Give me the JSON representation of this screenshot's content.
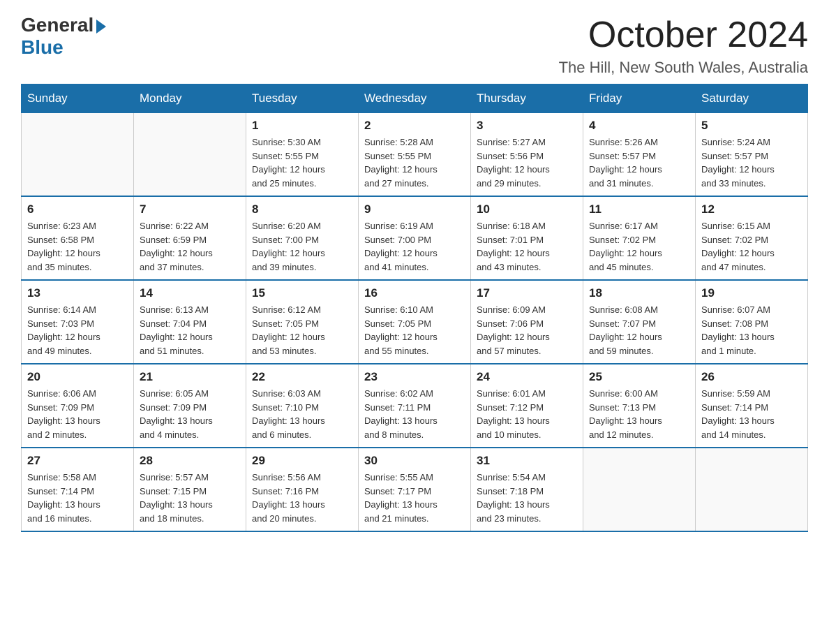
{
  "logo": {
    "general": "General",
    "blue": "Blue"
  },
  "header": {
    "month_year": "October 2024",
    "location": "The Hill, New South Wales, Australia"
  },
  "days_of_week": [
    "Sunday",
    "Monday",
    "Tuesday",
    "Wednesday",
    "Thursday",
    "Friday",
    "Saturday"
  ],
  "weeks": [
    [
      {
        "day": "",
        "info": ""
      },
      {
        "day": "",
        "info": ""
      },
      {
        "day": "1",
        "info": "Sunrise: 5:30 AM\nSunset: 5:55 PM\nDaylight: 12 hours\nand 25 minutes."
      },
      {
        "day": "2",
        "info": "Sunrise: 5:28 AM\nSunset: 5:55 PM\nDaylight: 12 hours\nand 27 minutes."
      },
      {
        "day": "3",
        "info": "Sunrise: 5:27 AM\nSunset: 5:56 PM\nDaylight: 12 hours\nand 29 minutes."
      },
      {
        "day": "4",
        "info": "Sunrise: 5:26 AM\nSunset: 5:57 PM\nDaylight: 12 hours\nand 31 minutes."
      },
      {
        "day": "5",
        "info": "Sunrise: 5:24 AM\nSunset: 5:57 PM\nDaylight: 12 hours\nand 33 minutes."
      }
    ],
    [
      {
        "day": "6",
        "info": "Sunrise: 6:23 AM\nSunset: 6:58 PM\nDaylight: 12 hours\nand 35 minutes."
      },
      {
        "day": "7",
        "info": "Sunrise: 6:22 AM\nSunset: 6:59 PM\nDaylight: 12 hours\nand 37 minutes."
      },
      {
        "day": "8",
        "info": "Sunrise: 6:20 AM\nSunset: 7:00 PM\nDaylight: 12 hours\nand 39 minutes."
      },
      {
        "day": "9",
        "info": "Sunrise: 6:19 AM\nSunset: 7:00 PM\nDaylight: 12 hours\nand 41 minutes."
      },
      {
        "day": "10",
        "info": "Sunrise: 6:18 AM\nSunset: 7:01 PM\nDaylight: 12 hours\nand 43 minutes."
      },
      {
        "day": "11",
        "info": "Sunrise: 6:17 AM\nSunset: 7:02 PM\nDaylight: 12 hours\nand 45 minutes."
      },
      {
        "day": "12",
        "info": "Sunrise: 6:15 AM\nSunset: 7:02 PM\nDaylight: 12 hours\nand 47 minutes."
      }
    ],
    [
      {
        "day": "13",
        "info": "Sunrise: 6:14 AM\nSunset: 7:03 PM\nDaylight: 12 hours\nand 49 minutes."
      },
      {
        "day": "14",
        "info": "Sunrise: 6:13 AM\nSunset: 7:04 PM\nDaylight: 12 hours\nand 51 minutes."
      },
      {
        "day": "15",
        "info": "Sunrise: 6:12 AM\nSunset: 7:05 PM\nDaylight: 12 hours\nand 53 minutes."
      },
      {
        "day": "16",
        "info": "Sunrise: 6:10 AM\nSunset: 7:05 PM\nDaylight: 12 hours\nand 55 minutes."
      },
      {
        "day": "17",
        "info": "Sunrise: 6:09 AM\nSunset: 7:06 PM\nDaylight: 12 hours\nand 57 minutes."
      },
      {
        "day": "18",
        "info": "Sunrise: 6:08 AM\nSunset: 7:07 PM\nDaylight: 12 hours\nand 59 minutes."
      },
      {
        "day": "19",
        "info": "Sunrise: 6:07 AM\nSunset: 7:08 PM\nDaylight: 13 hours\nand 1 minute."
      }
    ],
    [
      {
        "day": "20",
        "info": "Sunrise: 6:06 AM\nSunset: 7:09 PM\nDaylight: 13 hours\nand 2 minutes."
      },
      {
        "day": "21",
        "info": "Sunrise: 6:05 AM\nSunset: 7:09 PM\nDaylight: 13 hours\nand 4 minutes."
      },
      {
        "day": "22",
        "info": "Sunrise: 6:03 AM\nSunset: 7:10 PM\nDaylight: 13 hours\nand 6 minutes."
      },
      {
        "day": "23",
        "info": "Sunrise: 6:02 AM\nSunset: 7:11 PM\nDaylight: 13 hours\nand 8 minutes."
      },
      {
        "day": "24",
        "info": "Sunrise: 6:01 AM\nSunset: 7:12 PM\nDaylight: 13 hours\nand 10 minutes."
      },
      {
        "day": "25",
        "info": "Sunrise: 6:00 AM\nSunset: 7:13 PM\nDaylight: 13 hours\nand 12 minutes."
      },
      {
        "day": "26",
        "info": "Sunrise: 5:59 AM\nSunset: 7:14 PM\nDaylight: 13 hours\nand 14 minutes."
      }
    ],
    [
      {
        "day": "27",
        "info": "Sunrise: 5:58 AM\nSunset: 7:14 PM\nDaylight: 13 hours\nand 16 minutes."
      },
      {
        "day": "28",
        "info": "Sunrise: 5:57 AM\nSunset: 7:15 PM\nDaylight: 13 hours\nand 18 minutes."
      },
      {
        "day": "29",
        "info": "Sunrise: 5:56 AM\nSunset: 7:16 PM\nDaylight: 13 hours\nand 20 minutes."
      },
      {
        "day": "30",
        "info": "Sunrise: 5:55 AM\nSunset: 7:17 PM\nDaylight: 13 hours\nand 21 minutes."
      },
      {
        "day": "31",
        "info": "Sunrise: 5:54 AM\nSunset: 7:18 PM\nDaylight: 13 hours\nand 23 minutes."
      },
      {
        "day": "",
        "info": ""
      },
      {
        "day": "",
        "info": ""
      }
    ]
  ]
}
